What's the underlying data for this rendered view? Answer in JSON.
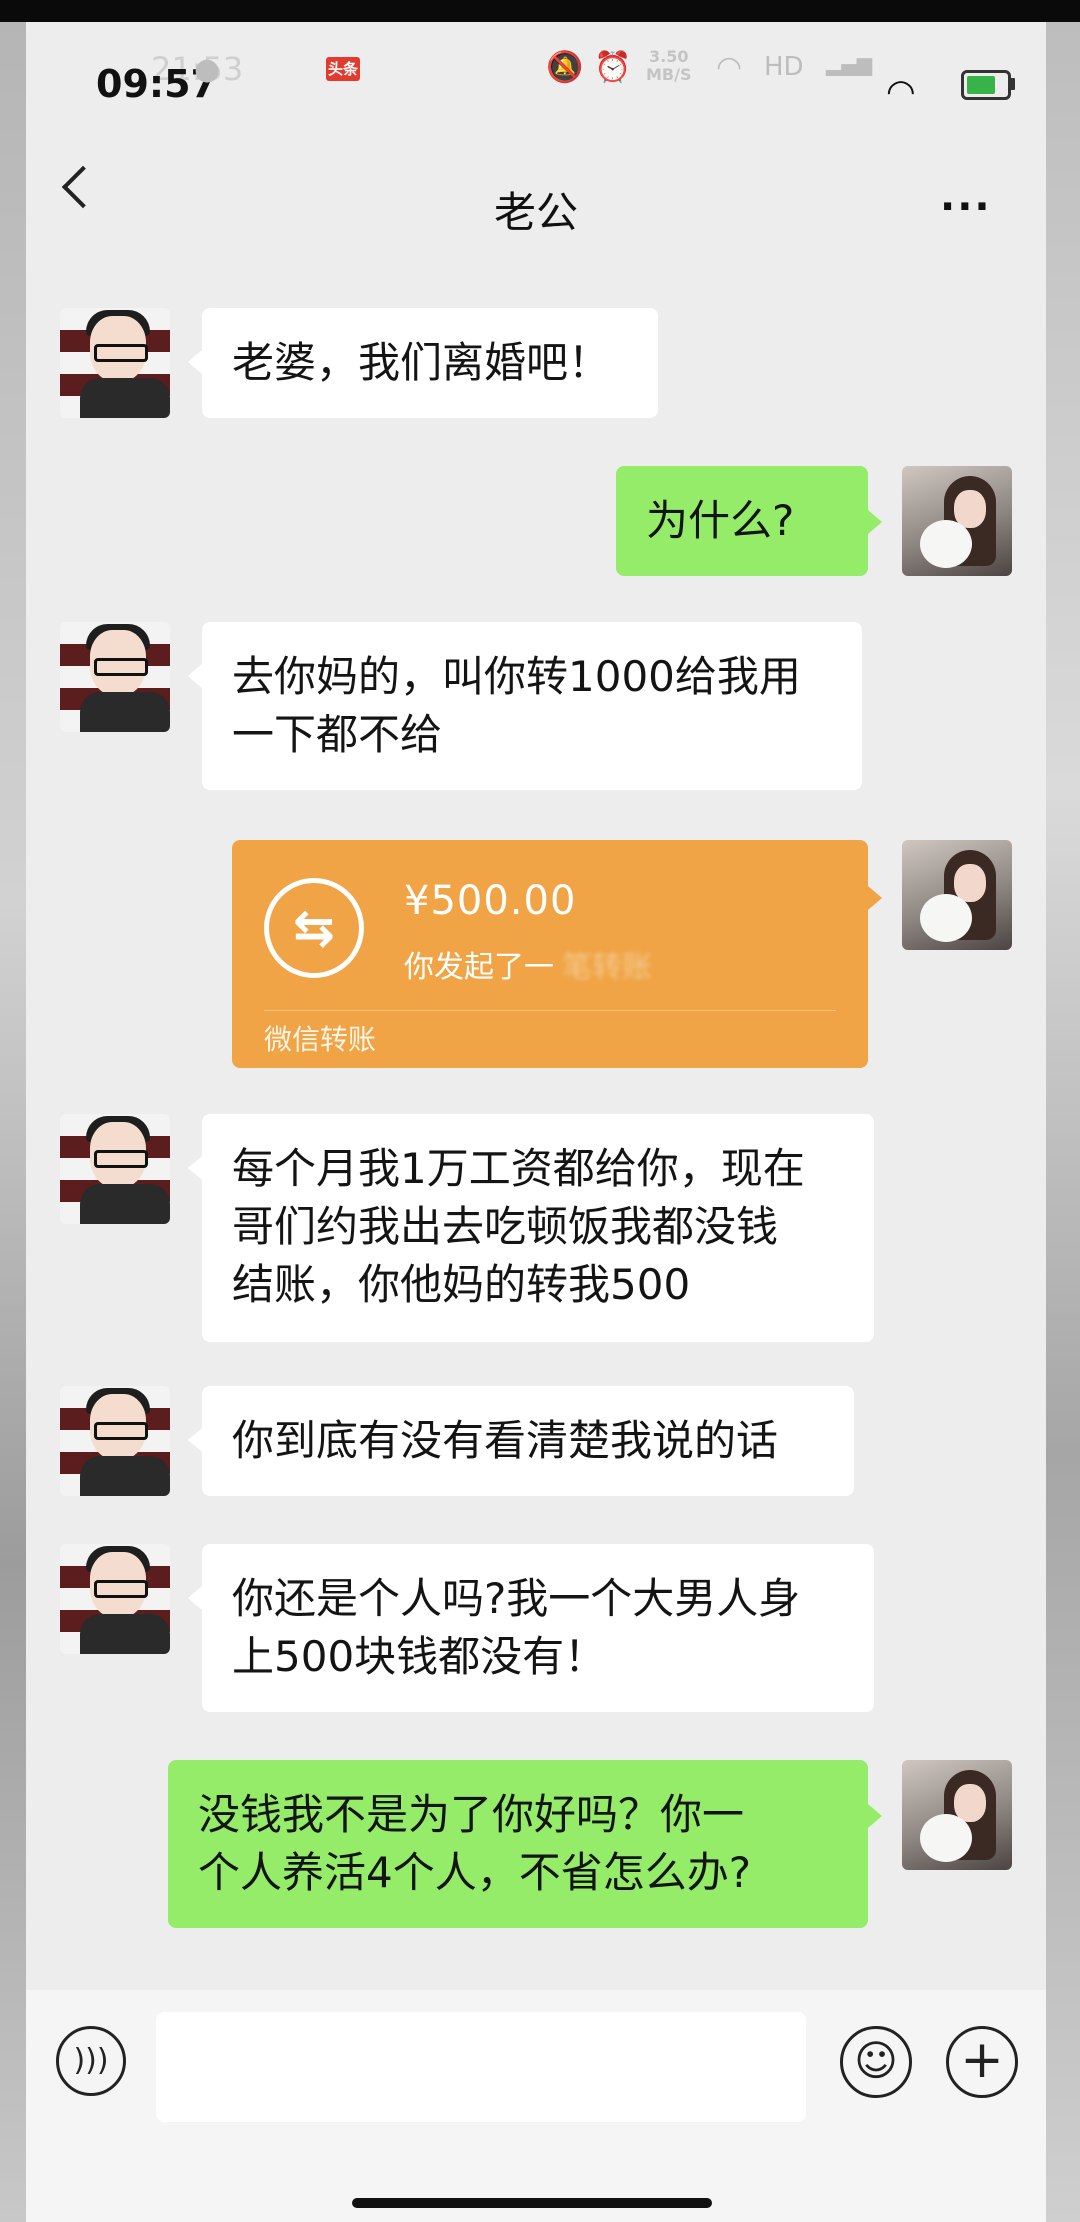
{
  "status_bar": {
    "time": "09:57",
    "ghost_time": "21:53",
    "net_speed_value": "3.50",
    "net_speed_unit": "MB/S",
    "network": "HD",
    "toutiao_badge": "头条"
  },
  "header": {
    "title": "老公",
    "back_icon": "chevron-left-icon",
    "more_label": "···"
  },
  "messages": [
    {
      "side": "in",
      "text": "老婆，我们离婚吧！"
    },
    {
      "side": "out",
      "text": "为什么?"
    },
    {
      "side": "in",
      "lines": [
        "去你妈的，叫你转1000给我用",
        "一下都不给"
      ]
    },
    {
      "side": "out",
      "type": "transfer",
      "amount": "¥500.00",
      "note": "你发起了一",
      "note_hidden": "笔转账",
      "label": "微信转账"
    },
    {
      "side": "in",
      "lines": [
        "每个月我1万工资都给你，现在",
        "哥们约我出去吃顿饭我都没钱",
        "结账，你他妈的转我500"
      ]
    },
    {
      "side": "in",
      "text": "你到底有没有看清楚我说的话"
    },
    {
      "side": "in",
      "lines": [
        "你还是个人吗?我一个大男人身",
        "上500块钱都没有！"
      ]
    },
    {
      "side": "out",
      "lines": [
        "没钱我不是为了你好吗？你一",
        "个人养活4个人，不省怎么办?"
      ]
    }
  ],
  "input_bar": {
    "voice_icon": "voice-icon",
    "emoji_icon": "emoji-icon",
    "plus_icon": "plus-icon"
  },
  "colors": {
    "chat_bg": "#ededed",
    "bubble_out": "#95ec69",
    "bubble_in": "#ffffff",
    "transfer": "#f0a445"
  }
}
